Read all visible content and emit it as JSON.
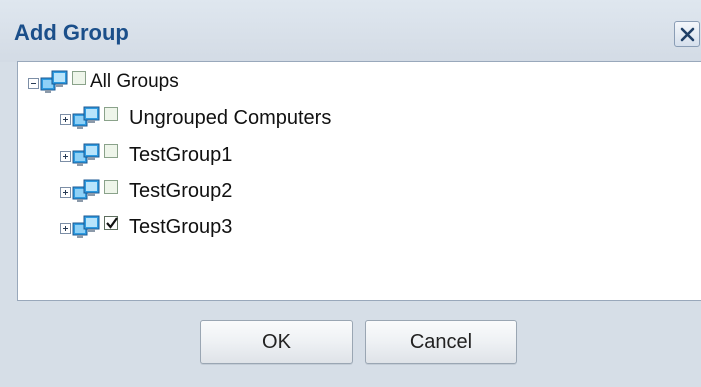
{
  "dialog": {
    "title": "Add Group",
    "close_icon": "close-icon"
  },
  "tree": {
    "root": {
      "label": "All Groups",
      "expanded": true,
      "checked": false,
      "icon": "computers-icon"
    },
    "children": [
      {
        "label": "Ungrouped Computers",
        "expanded": false,
        "checked": false,
        "icon": "computers-icon"
      },
      {
        "label": "TestGroup1",
        "expanded": false,
        "checked": false,
        "icon": "computers-icon"
      },
      {
        "label": "TestGroup2",
        "expanded": false,
        "checked": false,
        "icon": "computers-icon"
      },
      {
        "label": "TestGroup3",
        "expanded": false,
        "checked": true,
        "icon": "computers-icon"
      }
    ]
  },
  "buttons": {
    "ok_label": "OK",
    "cancel_label": "Cancel"
  },
  "colors": {
    "title": "#1b4f8a",
    "background": "#d6dee7",
    "panel": "#ffffff"
  }
}
